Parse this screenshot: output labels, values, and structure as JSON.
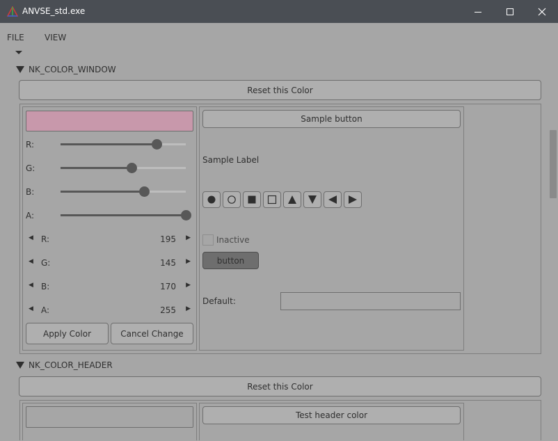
{
  "window": {
    "title": "ANVSE_std.exe",
    "minimize_icon": "minimize-icon",
    "maximize_icon": "maximize-icon",
    "close_icon": "close-icon"
  },
  "menu": {
    "items": [
      "FILE",
      "VIEW"
    ]
  },
  "colors": {
    "titlebar": "#4a4e54",
    "background": "#a6a6a6",
    "preview_window": "#c898ab",
    "preview_header": "#a6a6a6"
  },
  "color_window": {
    "header": "NK_COLOR_WINDOW",
    "reset_label": "Reset this Color",
    "sliders": [
      {
        "label": "R:",
        "fraction": 0.765
      },
      {
        "label": "G:",
        "fraction": 0.569
      },
      {
        "label": "B:",
        "fraction": 0.667
      },
      {
        "label": "A:",
        "fraction": 1.0
      }
    ],
    "properties": [
      {
        "label": "R:",
        "value": "195"
      },
      {
        "label": "G:",
        "value": "145"
      },
      {
        "label": "B:",
        "value": "170"
      },
      {
        "label": "A:",
        "value": "255"
      }
    ],
    "apply_label": "Apply Color",
    "cancel_label": "Cancel Change",
    "sample": {
      "button_label": "Sample button",
      "label": "Sample Label",
      "symbols": [
        "circle-solid-icon",
        "circle-outline-icon",
        "rect-solid-icon",
        "rect-outline-icon",
        "triangle-up-icon",
        "triangle-down-icon",
        "triangle-left-icon",
        "triangle-right-icon"
      ],
      "checkbox_label": "Inactive",
      "small_button_label": "button",
      "default_label": "Default:"
    }
  },
  "color_header": {
    "header": "NK_COLOR_HEADER",
    "reset_label": "Reset this Color",
    "test_label": "Test header color"
  }
}
